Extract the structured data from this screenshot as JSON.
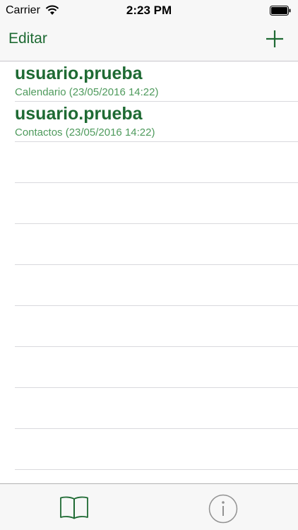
{
  "status_bar": {
    "carrier": "Carrier",
    "time": "2:23 PM",
    "wifi_icon": "wifi-icon",
    "battery_icon": "battery-icon"
  },
  "nav_bar": {
    "edit_label": "Editar",
    "add_icon": "plus-icon"
  },
  "list": {
    "items": [
      {
        "title": "usuario.prueba",
        "subtitle": "Calendario (23/05/2016 14:22)"
      },
      {
        "title": "usuario.prueba",
        "subtitle": "Contactos (23/05/2016 14:22)"
      }
    ]
  },
  "tab_bar": {
    "tabs": [
      {
        "icon": "book-icon"
      },
      {
        "icon": "info-icon"
      }
    ]
  },
  "colors": {
    "accent": "#1e6a33",
    "subtitle": "#4e9a5c",
    "bar_background": "#f7f7f7",
    "separator": "#d9d9dd"
  }
}
